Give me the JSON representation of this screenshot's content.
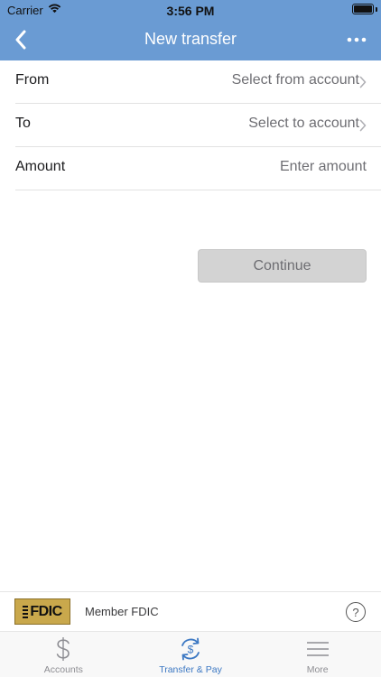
{
  "status_bar": {
    "carrier": "Carrier",
    "time": "3:56 PM"
  },
  "nav": {
    "title": "New transfer",
    "back_icon": "chevron-left-icon",
    "more_icon": "ellipsis-icon"
  },
  "form": {
    "rows": [
      {
        "label": "From",
        "value": "Select from account",
        "has_chevron": true
      },
      {
        "label": "To",
        "value": "Select to account",
        "has_chevron": true
      },
      {
        "label": "Amount",
        "value": "Enter amount",
        "has_chevron": false
      }
    ]
  },
  "continue_label": "Continue",
  "fdic": {
    "logo_text": "FDIC",
    "member_text": "Member FDIC",
    "help_glyph": "?"
  },
  "tabs": [
    {
      "label": "Accounts",
      "icon": "dollar-icon",
      "active": false
    },
    {
      "label": "Transfer & Pay",
      "icon": "transfer-dollar-icon",
      "active": true
    },
    {
      "label": "More",
      "icon": "hamburger-icon",
      "active": false
    }
  ],
  "colors": {
    "header": "#6a9bd3",
    "active_tab": "#3c78c3",
    "button_disabled": "#d3d3d3"
  }
}
